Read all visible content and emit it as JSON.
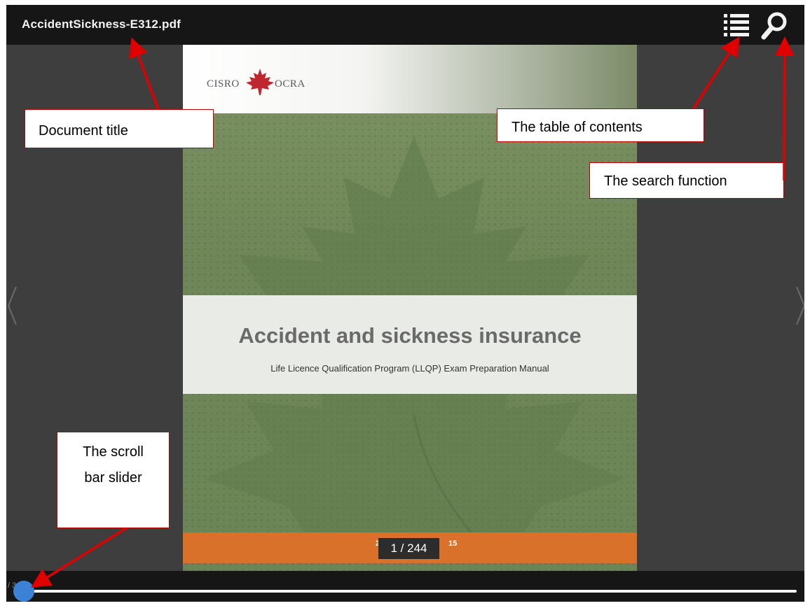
{
  "viewer": {
    "document_title": "AccidentSickness-E312.pdf",
    "toolbar": {
      "toc_icon": "list-icon",
      "search_icon": "search-icon"
    },
    "nav": {
      "prev_icon": "chevron-left-icon",
      "next_icon": "chevron-right-icon"
    },
    "page_counter": "1 / 244",
    "progress_label": "/ 3",
    "scroll_position": 0.0
  },
  "page": {
    "logo_left": "CISRO",
    "logo_right": "OCRA",
    "heading": "Accident and sickness insurance",
    "subheading": "Life Licence Qualification Program (LLQP) Exam Preparation Manual",
    "year_left": "2",
    "year_right": "15"
  },
  "annotations": {
    "document_title": "Document title",
    "table_of_contents": "The table of contents",
    "search_function": "The search function",
    "scroll_bar_slider_line1": "The scroll",
    "scroll_bar_slider_line2": "bar slider"
  },
  "colors": {
    "annotation_arrow": "#e00000",
    "page_green": "#6f8758",
    "orange_band": "#d9712b",
    "slider_thumb": "#3b82d6"
  }
}
